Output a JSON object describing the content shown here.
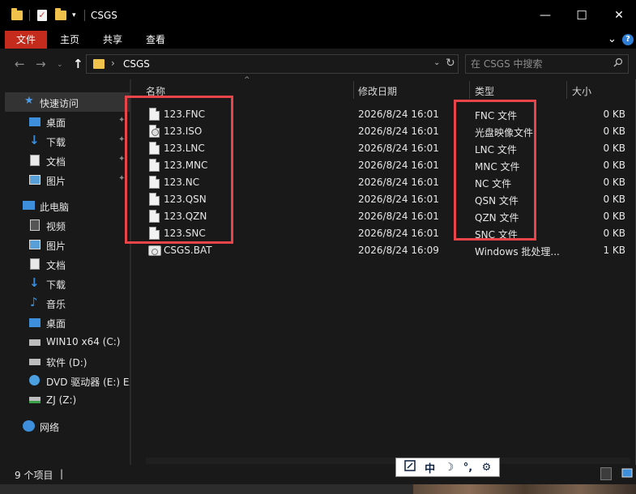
{
  "window": {
    "title": "CSGS",
    "controls": {
      "minimize": "—",
      "maximize": "☐",
      "close": "✕"
    }
  },
  "ribbon": {
    "tabs": [
      "文件",
      "主页",
      "共享",
      "查看"
    ],
    "expand_icon": "chevron-down-icon",
    "help_icon": "?"
  },
  "address": {
    "path": "CSGS",
    "search_placeholder": "在 CSGS 中搜索"
  },
  "sidebar": {
    "items": [
      {
        "label": "快速访问",
        "icon": "star-icon",
        "pinned": false,
        "selected": true
      },
      {
        "label": "桌面",
        "icon": "desktop-icon",
        "pinned": true
      },
      {
        "label": "下载",
        "icon": "download-icon",
        "pinned": true
      },
      {
        "label": "文档",
        "icon": "document-icon",
        "pinned": true
      },
      {
        "label": "图片",
        "icon": "picture-icon",
        "pinned": true
      },
      {
        "label": "此电脑",
        "icon": "computer-icon"
      },
      {
        "label": "视频",
        "icon": "video-icon"
      },
      {
        "label": "图片",
        "icon": "picture-icon"
      },
      {
        "label": "文档",
        "icon": "document-icon"
      },
      {
        "label": "下载",
        "icon": "download-icon"
      },
      {
        "label": "音乐",
        "icon": "music-icon"
      },
      {
        "label": "桌面",
        "icon": "desktop-icon"
      },
      {
        "label": "WIN10 x64 (C:)",
        "icon": "drive-icon"
      },
      {
        "label": "软件 (D:)",
        "icon": "drive-icon"
      },
      {
        "label": "DVD 驱动器 (E:) EA",
        "icon": "dvd-icon"
      },
      {
        "label": "ZJ (Z:)",
        "icon": "network-drive-icon"
      },
      {
        "label": "网络",
        "icon": "network-icon"
      }
    ]
  },
  "columns": {
    "name": "名称",
    "date": "修改日期",
    "type": "类型",
    "size": "大小"
  },
  "files": [
    {
      "name": "123.FNC",
      "date": "2026/8/24 16:01",
      "type": "FNC 文件",
      "size": "0 KB",
      "icon": "file-icon"
    },
    {
      "name": "123.ISO",
      "date": "2026/8/24 16:01",
      "type": "光盘映像文件",
      "size": "0 KB",
      "icon": "disc-image-icon"
    },
    {
      "name": "123.LNC",
      "date": "2026/8/24 16:01",
      "type": "LNC 文件",
      "size": "0 KB",
      "icon": "file-icon"
    },
    {
      "name": "123.MNC",
      "date": "2026/8/24 16:01",
      "type": "MNC 文件",
      "size": "0 KB",
      "icon": "file-icon"
    },
    {
      "name": "123.NC",
      "date": "2026/8/24 16:01",
      "type": "NC 文件",
      "size": "0 KB",
      "icon": "file-icon"
    },
    {
      "name": "123.QSN",
      "date": "2026/8/24 16:01",
      "type": "QSN 文件",
      "size": "0 KB",
      "icon": "file-icon"
    },
    {
      "name": "123.QZN",
      "date": "2026/8/24 16:01",
      "type": "QZN 文件",
      "size": "0 KB",
      "icon": "file-icon"
    },
    {
      "name": "123.SNC",
      "date": "2026/8/24 16:01",
      "type": "SNC 文件",
      "size": "0 KB",
      "icon": "file-icon"
    },
    {
      "name": "CSGS.BAT",
      "date": "2026/8/24 16:09",
      "type": "Windows 批处理...",
      "size": "1 KB",
      "icon": "batch-file-icon"
    }
  ],
  "status": {
    "item_count": "9 个项目",
    "cursor": "|"
  },
  "ime": {
    "mode": "中",
    "moon": "☽",
    "punct": "°,",
    "settings": "⚙"
  },
  "colors": {
    "highlight": "#e8444a",
    "file_tab": "#c42b1c",
    "folder": "#f0c24b",
    "accent_blue": "#2e7ed6"
  }
}
